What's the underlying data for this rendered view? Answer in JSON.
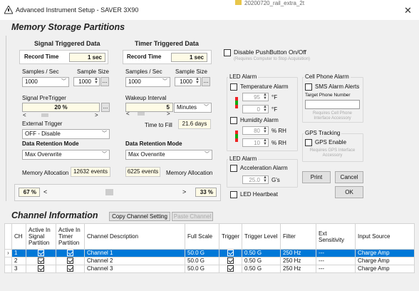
{
  "window": {
    "title": "Advanced Instrument Setup - SAVER 3X90",
    "background_tab": "20200720_rail_extra_2t"
  },
  "memory": {
    "heading": "Memory Storage Partitions",
    "signal": {
      "heading": "Signal Triggered Data",
      "record_time_label": "Record Time",
      "record_time_value": "1 sec",
      "samples_label": "Samples / Sec",
      "sample_size_label": "Sample Size",
      "samples_value": "1000",
      "sample_size_value": "1000",
      "pretrigger_label": "Signal PreTrigger",
      "pretrigger_value": "20 %",
      "external_trigger_label": "External Trigger",
      "external_trigger_value": "OFF - Disable",
      "retention_label": "Data Retention Mode",
      "retention_value": "Max Overwrite",
      "allocation_label": "Memory Allocation",
      "allocation_value": "12632 events"
    },
    "timer": {
      "heading": "Timer Triggered Data",
      "record_time_label": "Record Time",
      "record_time_value": "1 sec",
      "samples_label": "Samples / Sec",
      "sample_size_label": "Sample Size",
      "samples_value": "1000",
      "sample_size_value": "1000",
      "wakeup_label": "Wakeup Interval",
      "wakeup_value": "5",
      "wakeup_unit": "Minutes",
      "time_to_fill_label": "Time to Fill",
      "time_to_fill_value": "21.6 days",
      "retention_label": "Data Retention Mode",
      "retention_value": "Max Overwrite",
      "allocation_label": "Memory Allocation",
      "allocation_value": "6225 events"
    },
    "split": {
      "left_value": "67 %",
      "right_value": "33 %",
      "left_arrow": "<",
      "right_arrow": ">",
      "left_fraction": 0.67
    },
    "ellipsis": "..."
  },
  "options": {
    "disable_pushbutton_label": "Disable PushButton On/Off",
    "disable_pushbutton_note": "(Requires Computer to Stop Acquisition)",
    "led_alarm_group": "LED Alarm",
    "temperature_alarm_label": "Temperature Alarm",
    "temp_high": "95",
    "temp_low": "0",
    "temp_unit": "°F",
    "humidity_alarm_label": "Humidity Alarm",
    "hum_high": "80",
    "hum_low": "10",
    "hum_unit": "% RH",
    "led_alarm_group2": "LED Alarm",
    "acceleration_alarm_label": "Acceleration Alarm",
    "accel_value": "25.0",
    "accel_unit": "G's",
    "led_heartbeat_label": "LED Heartbeat",
    "cell_group": "Cell Phone Alarm",
    "sms_label": "SMS Alarm Alerts",
    "target_phone_label": "Target Phone Number",
    "target_phone_value": "",
    "cell_note": "Requires Cell Phone Interface Accessory",
    "gps_group": "GPS Tracking",
    "gps_label": "GPS Enable",
    "gps_note": "Requires GPS Interface Accessory",
    "print_label": "Print",
    "cancel_label": "Cancel",
    "ok_label": "OK"
  },
  "channels": {
    "heading": "Channel Information",
    "copy_label": "Copy Channel Setting",
    "paste_label": "Paste Channel",
    "columns": [
      "",
      "CH",
      "Active In Signal Partition",
      "Active In Timer Partition",
      "Channel Description",
      "Full Scale",
      "Trigger",
      "Trigger Level",
      "Filter",
      "Ext Sensitivity",
      "Input Source"
    ],
    "rows": [
      {
        "ch": "1",
        "desc": "Channel 1",
        "full_scale": "50.0 G",
        "trig_level": "0.50 G",
        "filter": "250 Hz",
        "ext": "---",
        "source": "Charge Amp",
        "selected": true
      },
      {
        "ch": "2",
        "desc": "Channel 2",
        "full_scale": "50.0 G",
        "trig_level": "0.50 G",
        "filter": "250 Hz",
        "ext": "---",
        "source": "Charge Amp",
        "selected": false
      },
      {
        "ch": "3",
        "desc": "Channel 3",
        "full_scale": "50.0 G",
        "trig_level": "0.50 G",
        "filter": "250 Hz",
        "ext": "---",
        "source": "Charge Amp",
        "selected": false
      }
    ]
  }
}
